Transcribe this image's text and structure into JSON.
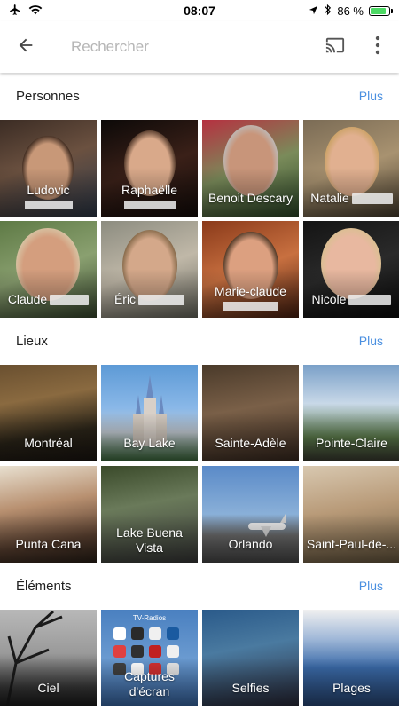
{
  "status": {
    "time": "08:07",
    "battery": "86 %",
    "battery_level": 0.86
  },
  "search": {
    "placeholder": "Rechercher"
  },
  "sections": {
    "people": {
      "title": "Personnes",
      "more": "Plus",
      "tiles": [
        {
          "name": "Ludovic",
          "bg": "linear-gradient(160deg,#3b2c24 0%,#6b5140 45%,#2f3a4a 100%)",
          "face": "#c89878",
          "hair": "#2a1a12"
        },
        {
          "name": "Raphaëlle",
          "bg": "linear-gradient(160deg,#0c0908 0%,#3a2018 50%,#140c0a 100%)",
          "face": "#d9a98a",
          "hair": "#3a2418"
        },
        {
          "name": "Benoit Descary",
          "bg": "linear-gradient(160deg,#b63040 0%,#7a8b5a 50%,#2e4a2a 100%)",
          "face": "#c8957a",
          "hair": "#bdbdbd"
        },
        {
          "name": "Natalie",
          "bg": "linear-gradient(160deg,#7a6b55 0%,#a89270 50%,#4a4030 100%)",
          "face": "#e1b090",
          "hair": "#c8a060"
        },
        {
          "name": "Claude",
          "bg": "linear-gradient(160deg,#5e7a45 0%,#8aa070 50%,#3a4a30 100%)",
          "face": "#d49e7e",
          "hair": "#d8c8a8"
        },
        {
          "name": "Éric",
          "bg": "linear-gradient(160deg,#8c8c80 0%,#c0b8a8 50%,#6a6a60 100%)",
          "face": "#d4a88a",
          "hair": "#7a6040"
        },
        {
          "name": "Marie-claude",
          "bg": "linear-gradient(160deg,#8a3a1a 0%,#c87040 50%,#4a2010 100%)",
          "face": "#dca080",
          "hair": "#3a2818"
        },
        {
          "name": "Nicole",
          "bg": "linear-gradient(160deg,#141414 0%,#2a2a2a 50%,#0a0a0a 100%)",
          "face": "#e8b8a0",
          "hair": "#d8c090"
        }
      ]
    },
    "places": {
      "title": "Lieux",
      "more": "Plus",
      "tiles": [
        {
          "name": "Montréal",
          "bg": "linear-gradient(170deg,#6a5030 0%,#8a6a40 35%,#2a2418 70%,#1a1410 100%)"
        },
        {
          "name": "Bay Lake",
          "bg": "linear-gradient(180deg,#5d9ad6 0%,#8ab8e8 45%,#c0c8d0 70%,#3a6a3a 100%)"
        },
        {
          "name": "Sainte-Adèle",
          "bg": "linear-gradient(170deg,#4a3a2a 0%,#7a6048 45%,#3a2a20 100%)"
        },
        {
          "name": "Pointe-Claire",
          "bg": "linear-gradient(180deg,#7aa0c8 0%,#c8d8e8 40%,#5a7a4a 75%,#3a3a30 100%)"
        },
        {
          "name": "Punta Cana",
          "bg": "linear-gradient(170deg,#e8e0d0 0%,#b89070 40%,#5a4030 75%,#2a2018 100%)"
        },
        {
          "name": "Lake Buena Vista",
          "bg": "linear-gradient(170deg,#3a4a2a 0%,#6a7a5a 40%,#3a3a3a 100%)"
        },
        {
          "name": "Orlando",
          "bg": "linear-gradient(180deg,#5a8ac8 0%,#8ab0d8 50%,#6a6a6a 72%,#4a4a4a 100%)"
        },
        {
          "name": "Saint-Paul-de-...",
          "bg": "linear-gradient(170deg,#d8c8b0 0%,#b89a78 45%,#6a5a40 100%)"
        }
      ]
    },
    "things": {
      "title": "Éléments",
      "more": "Plus",
      "tiles": [
        {
          "name": "Ciel",
          "bg": "linear-gradient(180deg,#b8b8b8 0%,#9a9a9a 45%,#3a3a3a 80%,#1a1a1a 100%)"
        },
        {
          "name": "Captures d'écran",
          "bg": "linear-gradient(180deg,#4a80c0 0%,#6a9ad0 50%,#3a6aa8 100%)",
          "caption": "TV-Radios"
        },
        {
          "name": "Selfies",
          "bg": "linear-gradient(170deg,#2a5a8a 0%,#4a7aa0 40%,#2a2a3a 100%)"
        },
        {
          "name": "Plages",
          "bg": "linear-gradient(180deg,#f0f0f0 0%,#a0b8d8 30%,#3a6aa8 60%,#2a4a7a 100%)"
        }
      ]
    }
  }
}
